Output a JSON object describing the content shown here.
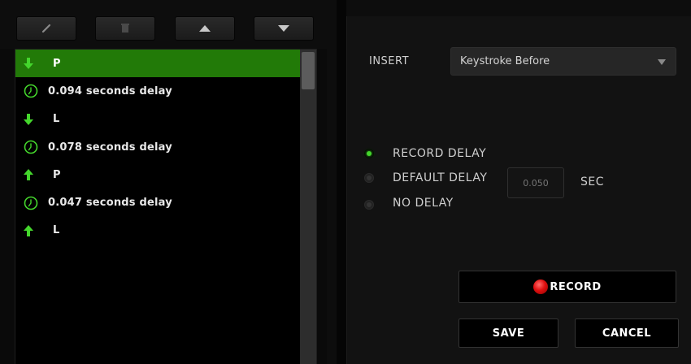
{
  "toolbar": {
    "buttons": [
      {
        "icon": "edit-icon"
      },
      {
        "icon": "delete-icon"
      },
      {
        "icon": "move-up-icon"
      },
      {
        "icon": "move-down-icon"
      }
    ]
  },
  "macro_list": {
    "items": [
      {
        "kind": "key-down",
        "icon": "arrow-down-icon",
        "label": "P",
        "selected": true
      },
      {
        "kind": "delay",
        "icon": "clock-icon",
        "label": "0.094 seconds delay",
        "selected": false
      },
      {
        "kind": "key-down",
        "icon": "arrow-down-icon",
        "label": "L",
        "selected": false
      },
      {
        "kind": "delay",
        "icon": "clock-icon",
        "label": "0.078 seconds delay",
        "selected": false
      },
      {
        "kind": "key-up",
        "icon": "arrow-up-icon",
        "label": "P",
        "selected": false
      },
      {
        "kind": "delay",
        "icon": "clock-icon",
        "label": "0.047 seconds delay",
        "selected": false
      },
      {
        "kind": "key-up",
        "icon": "arrow-up-icon",
        "label": "L",
        "selected": false
      }
    ]
  },
  "insert": {
    "label": "INSERT",
    "selected": "Keystroke Before"
  },
  "delay_options": {
    "record_delay": {
      "label": "RECORD DELAY",
      "checked": true
    },
    "default_delay": {
      "label": "DEFAULT DELAY",
      "checked": false,
      "value": "",
      "placeholder": "0.050",
      "unit": "SEC"
    },
    "no_delay": {
      "label": "NO DELAY",
      "checked": false
    }
  },
  "actions": {
    "record": "RECORD",
    "save": "SAVE",
    "cancel": "CANCEL"
  },
  "colors": {
    "accent": "#44d62c",
    "selected_row": "#227a08",
    "record": "#e01010"
  }
}
